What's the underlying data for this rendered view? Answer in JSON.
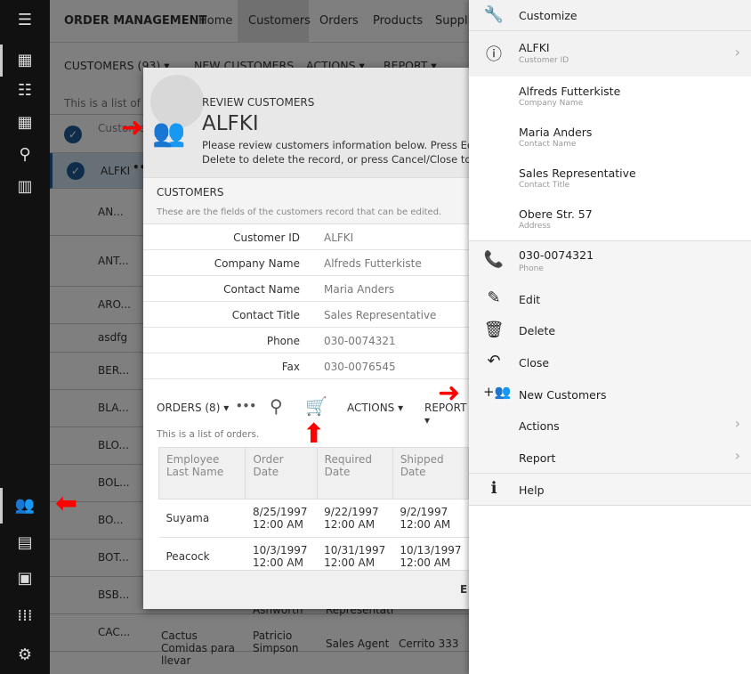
{
  "app": {
    "title": "ORDER MANAGEMENT",
    "nav": [
      "Home",
      "Customers",
      "Orders",
      "Products",
      "Supplie"
    ],
    "active_nav": "Customers"
  },
  "toolbar": {
    "customers": "CUSTOMERS (93)",
    "new_customers": "NEW CUSTOMERS",
    "actions": "ACTIONS",
    "report": "REPORT"
  },
  "list": {
    "description": "This is a list of cust",
    "header": "Customer ID",
    "selected": "ALFKI",
    "rows": [
      "AN...",
      "ANT...",
      "ARO...",
      "asdfg",
      "BER...",
      "BLA...",
      "BLO...",
      "BOL...",
      "BO...",
      "BOT...",
      "BSB...",
      "CAC..."
    ],
    "extra": {
      "bsb_contact": "Ashworth",
      "bsb_title": "Representati",
      "cac_company": "Cactus Comidas para llevar",
      "cac_contact": "Patricio Simpson",
      "cac_title": "Sales Agent",
      "cac_address": "Cerrito 333"
    }
  },
  "modal": {
    "kicker": "REVIEW CUSTOMERS",
    "title": "ALFKI",
    "desc1": "Please review customers information below. Press Edit to",
    "desc2": "Delete to delete the record, or press Cancel/Close to retu",
    "section": "CUSTOMERS",
    "section_desc": "These are the fields of the customers record that can be edited.",
    "fields": [
      {
        "label": "Customer ID",
        "value": "ALFKI"
      },
      {
        "label": "Company Name",
        "value": "Alfreds Futterkiste"
      },
      {
        "label": "Contact Name",
        "value": "Maria Anders"
      },
      {
        "label": "Contact Title",
        "value": "Sales Representative"
      },
      {
        "label": "Phone",
        "value": "030-0074321"
      },
      {
        "label": "Fax",
        "value": "030-0076545"
      }
    ],
    "orders": {
      "title": "ORDERS (8)",
      "actions": "ACTIONS",
      "report": "REPORT",
      "desc": "This is a list of orders.",
      "columns": [
        "Employee Last Name",
        "Order Date",
        "Required Date",
        "Shipped Date"
      ],
      "rows": [
        [
          "Suyama",
          "8/25/1997 12:00 AM",
          "9/22/1997 12:00 AM",
          "9/2/1997 12:00 AM"
        ],
        [
          "Peacock",
          "10/3/1997 12:00 AM",
          "10/31/1997 12:00 AM",
          "10/13/1997 12:00 AM"
        ]
      ]
    },
    "footer_button": "E"
  },
  "panel": {
    "customize": "Customize",
    "id": {
      "value": "ALFKI",
      "label": "Customer ID"
    },
    "details": [
      {
        "value": "Alfreds Futterkiste",
        "label": "Company Name"
      },
      {
        "value": "Maria Anders",
        "label": "Contact Name"
      },
      {
        "value": "Sales Representative",
        "label": "Contact Title"
      },
      {
        "value": "Obere Str. 57",
        "label": "Address"
      }
    ],
    "phone": {
      "value": "030-0074321",
      "label": "Phone"
    },
    "edit": "Edit",
    "delete": "Delete",
    "close": "Close",
    "new_customers": "New Customers",
    "actions": "Actions",
    "report": "Report",
    "help": "Help"
  },
  "colors": {
    "accent": "#1e5a96",
    "annotation": "#ff0000",
    "sidebar": "#111111"
  }
}
